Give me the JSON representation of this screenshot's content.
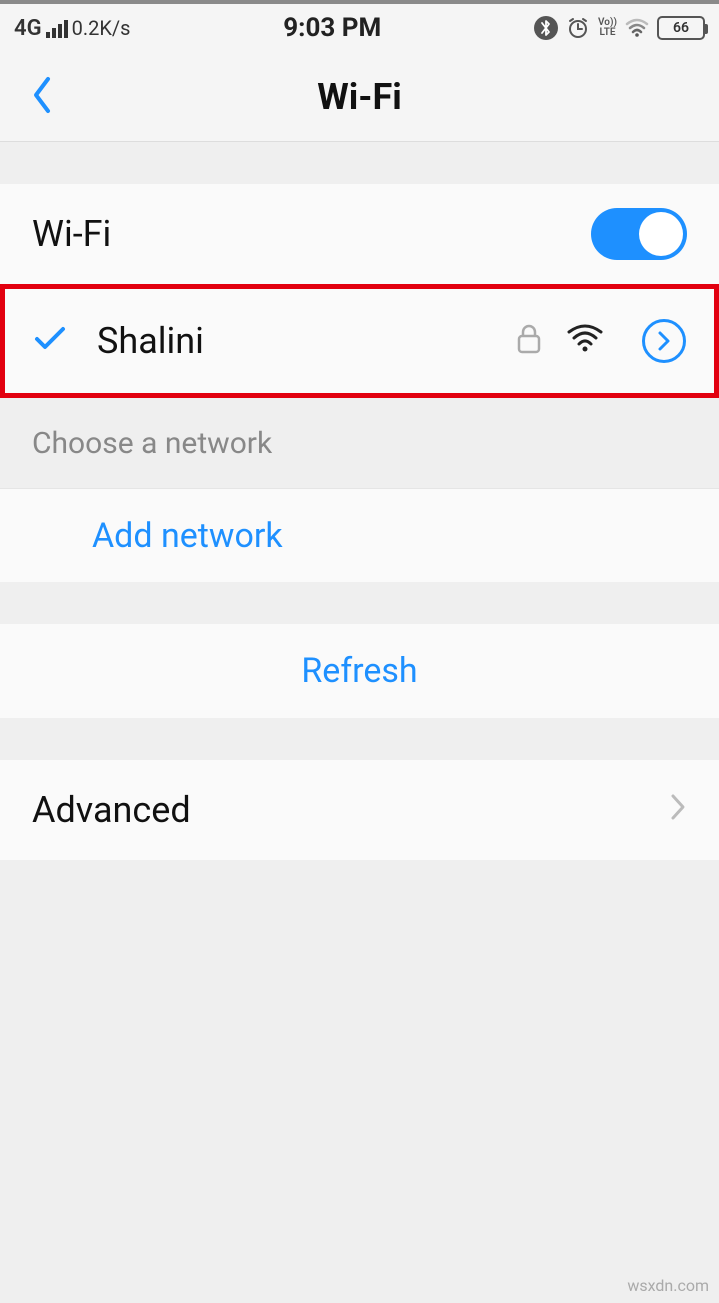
{
  "status_bar": {
    "network_type": "4G",
    "data_speed": "0.2K/s",
    "time": "9:03 PM",
    "volte_line1": "Vo))",
    "volte_line2": "LTE",
    "battery_percent": "66"
  },
  "header": {
    "title": "Wi-Fi"
  },
  "wifi_toggle": {
    "label": "Wi-Fi",
    "enabled": true
  },
  "connected_network": {
    "name": "Shalini",
    "secured": true
  },
  "section_choose": {
    "label": "Choose a network"
  },
  "actions": {
    "add_network": "Add network",
    "refresh": "Refresh",
    "advanced": "Advanced"
  },
  "watermark": "wsxdn.com"
}
